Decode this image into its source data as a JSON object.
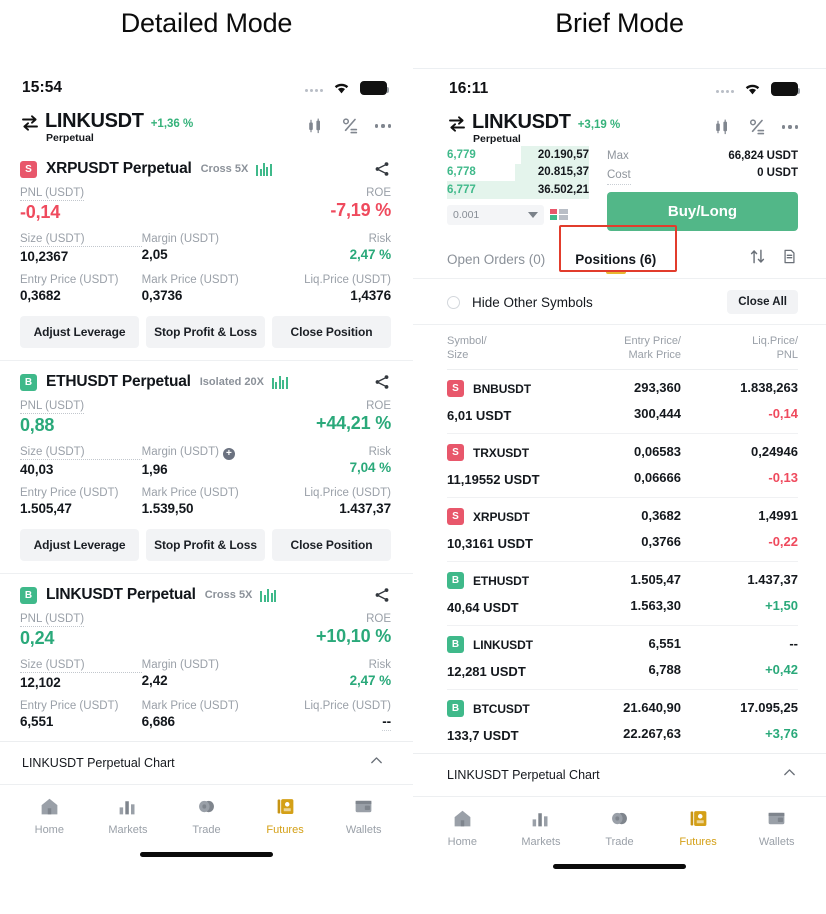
{
  "titles": {
    "left": "Detailed Mode",
    "right": "Brief Mode"
  },
  "left": {
    "status": {
      "time": "15:54"
    },
    "header": {
      "symbol": "LINKUSDT",
      "change": "+1,36 %",
      "subtitle": "Perpetual",
      "icons": [
        "swap-icon",
        "candlestick-icon",
        "percent-icon",
        "more-icon"
      ]
    },
    "positions": [
      {
        "side": "S",
        "title": "XRPUSDT Perpetual",
        "leverage": "Cross 5X",
        "pnl_label": "PNL (USDT)",
        "pnl_value": "-0,14",
        "pnl_sign": "neg",
        "roe_label": "ROE",
        "roe_value": "-7,19 %",
        "size_label": "Size (USDT)",
        "size_value": "10,2367",
        "margin_label": "Margin (USDT)",
        "margin_value": "2,05",
        "margin_plus": false,
        "risk_label": "Risk",
        "risk_value": "2,47 %",
        "entry_label": "Entry Price (USDT)",
        "entry_value": "0,3682",
        "mark_label": "Mark Price (USDT)",
        "mark_value": "0,3736",
        "liq_label": "Liq.Price (USDT)",
        "liq_value": "1,4376",
        "buttons": [
          "Adjust Leverage",
          "Stop Profit & Loss",
          "Close Position"
        ]
      },
      {
        "side": "B",
        "title": "ETHUSDT Perpetual",
        "leverage": "Isolated 20X",
        "pnl_label": "PNL (USDT)",
        "pnl_value": "0,88",
        "pnl_sign": "pos",
        "roe_label": "ROE",
        "roe_value": "+44,21 %",
        "size_label": "Size (USDT)",
        "size_value": "40,03",
        "margin_label": "Margin (USDT)",
        "margin_value": "1,96",
        "margin_plus": true,
        "risk_label": "Risk",
        "risk_value": "7,04 %",
        "entry_label": "Entry Price (USDT)",
        "entry_value": "1.505,47",
        "mark_label": "Mark Price (USDT)",
        "mark_value": "1.539,50",
        "liq_label": "Liq.Price (USDT)",
        "liq_value": "1.437,37",
        "buttons": [
          "Adjust Leverage",
          "Stop Profit & Loss",
          "Close Position"
        ]
      },
      {
        "side": "B",
        "title": "LINKUSDT Perpetual",
        "leverage": "Cross 5X",
        "pnl_label": "PNL (USDT)",
        "pnl_value": "0,24",
        "pnl_sign": "pos",
        "roe_label": "ROE",
        "roe_value": "+10,10 %",
        "size_label": "Size (USDT)",
        "size_value": "12,102",
        "margin_label": "Margin (USDT)",
        "margin_value": "2,42",
        "margin_plus": false,
        "risk_label": "Risk",
        "risk_value": "2,47 %",
        "entry_label": "Entry Price (USDT)",
        "entry_value": "6,551",
        "mark_label": "Mark Price (USDT)",
        "mark_value": "6,686",
        "liq_label": "Liq.Price (USDT)",
        "liq_value": "--",
        "buttons": []
      }
    ],
    "chartbar": {
      "text": "LINKUSDT Perpetual  Chart",
      "chevron": "chevron-up-icon"
    },
    "nav": [
      {
        "label": "Home",
        "icon": "home-icon",
        "active": false
      },
      {
        "label": "Markets",
        "icon": "bar-chart-icon",
        "active": false
      },
      {
        "label": "Trade",
        "icon": "coins-icon",
        "active": false
      },
      {
        "label": "Futures",
        "icon": "futures-icon",
        "active": true
      },
      {
        "label": "Wallets",
        "icon": "wallet-icon",
        "active": false
      }
    ]
  },
  "right": {
    "status": {
      "time": "16:11"
    },
    "header": {
      "symbol": "LINKUSDT",
      "change": "+3,19 %",
      "subtitle": "Perpetual",
      "icons": [
        "swap-icon",
        "candlestick-icon",
        "percent-icon",
        "more-icon"
      ]
    },
    "orderbook": {
      "rows": [
        {
          "price": "6,779",
          "qty": "20.190,57",
          "fill": 48
        },
        {
          "price": "6,778",
          "qty": "20.815,37",
          "fill": 52
        },
        {
          "price": "6,777",
          "qty": "36.502,21",
          "fill": 100
        }
      ],
      "tick_value": "0.001",
      "depth_icon": "depth-icon"
    },
    "order": {
      "max_label": "Max",
      "max_value": "66,824 USDT",
      "cost_label": "Cost",
      "cost_value": "0 USDT",
      "buy_label": "Buy/Long"
    },
    "tabs": [
      {
        "label": "Open Orders (0)",
        "active": false
      },
      {
        "label": "Positions (6)",
        "active": true
      }
    ],
    "tab_icons": [
      "sort-icon",
      "document-icon"
    ],
    "hide_row": {
      "label": "Hide Other Symbols",
      "close_all": "Close All"
    },
    "table_headers": {
      "c1_top": "Symbol/",
      "c1_bot": "Size",
      "c2_top": "Entry Price/",
      "c2_bot": "Mark Price",
      "c3_top": "Liq.Price/",
      "c3_bot": "PNL"
    },
    "rows": [
      {
        "side": "S",
        "symbol": "BNBUSDT",
        "size": "6,01 USDT",
        "entry": "293,360",
        "mark": "300,444",
        "liq": "1.838,263",
        "pnl": "-0,14",
        "pnl_sign": "neg"
      },
      {
        "side": "S",
        "symbol": "TRXUSDT",
        "size": "11,19552 USDT",
        "entry": "0,06583",
        "mark": "0,06666",
        "liq": "0,24946",
        "pnl": "-0,13",
        "pnl_sign": "neg"
      },
      {
        "side": "S",
        "symbol": "XRPUSDT",
        "size": "10,3161 USDT",
        "entry": "0,3682",
        "mark": "0,3766",
        "liq": "1,4991",
        "pnl": "-0,22",
        "pnl_sign": "neg"
      },
      {
        "side": "B",
        "symbol": "ETHUSDT",
        "size": "40,64 USDT",
        "entry": "1.505,47",
        "mark": "1.563,30",
        "liq": "1.437,37",
        "pnl": "+1,50",
        "pnl_sign": "pos"
      },
      {
        "side": "B",
        "symbol": "LINKUSDT",
        "size": "12,281 USDT",
        "entry": "6,551",
        "mark": "6,788",
        "liq": "--",
        "pnl": "+0,42",
        "pnl_sign": "pos"
      },
      {
        "side": "B",
        "symbol": "BTCUSDT",
        "size": "133,7 USDT",
        "entry": "21.640,90",
        "mark": "22.267,63",
        "liq": "17.095,25",
        "pnl": "+3,76",
        "pnl_sign": "pos"
      }
    ],
    "chartbar": {
      "text": "LINKUSDT Perpetual  Chart",
      "chevron": "chevron-up-icon"
    },
    "nav": [
      {
        "label": "Home",
        "icon": "home-icon",
        "active": false
      },
      {
        "label": "Markets",
        "icon": "bar-chart-icon",
        "active": false
      },
      {
        "label": "Trade",
        "icon": "coins-icon",
        "active": false
      },
      {
        "label": "Futures",
        "icon": "futures-icon",
        "active": true
      },
      {
        "label": "Wallets",
        "icon": "wallet-icon",
        "active": false
      }
    ]
  },
  "colors": {
    "green": "#2aa97a",
    "red": "#ef4a5d",
    "buy_green": "#52b788",
    "badge_sell": "#e8576b",
    "badge_buy": "#3fb98a",
    "accent_yellow": "#e8b730",
    "nav_active": "#d4a017",
    "highlight_box": "#e23c2c"
  }
}
